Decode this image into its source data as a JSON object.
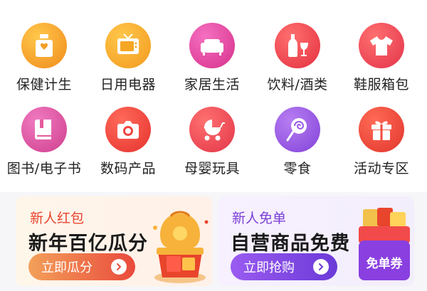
{
  "categories": [
    {
      "label": "保健计生",
      "icon": "health-bottle-icon",
      "color": "#f3a02a"
    },
    {
      "label": "日用电器",
      "icon": "tv-icon",
      "color": "#f5a623"
    },
    {
      "label": "家居生活",
      "icon": "sofa-icon",
      "color": "#e6459a"
    },
    {
      "label": "饮料/酒类",
      "icon": "wine-icon",
      "color": "#ef4550"
    },
    {
      "label": "鞋服箱包",
      "icon": "tshirt-icon",
      "color": "#ee4a55"
    },
    {
      "label": "图书/电子书",
      "icon": "book-icon",
      "color": "#e45a9c"
    },
    {
      "label": "数码产品",
      "icon": "camera-icon",
      "color": "#f0453f"
    },
    {
      "label": "母婴玩具",
      "icon": "baby-stroller-icon",
      "color": "#ef4a55"
    },
    {
      "label": "零食",
      "icon": "lollipop-icon",
      "color": "#9b59e6"
    },
    {
      "label": "活动专区",
      "icon": "gift-icon",
      "color": "#ef4a3c"
    }
  ],
  "banners": {
    "left": {
      "subtitle": "新人红包",
      "title": "新年百亿瓜分",
      "button": "立即瓜分"
    },
    "right": {
      "subtitle": "新人免单",
      "title": "自营商品免费",
      "button": "立即抢购",
      "coupon_text": "免单券"
    }
  },
  "colors": {
    "left_accent": "#e8442f",
    "right_accent": "#7b3fd6"
  }
}
